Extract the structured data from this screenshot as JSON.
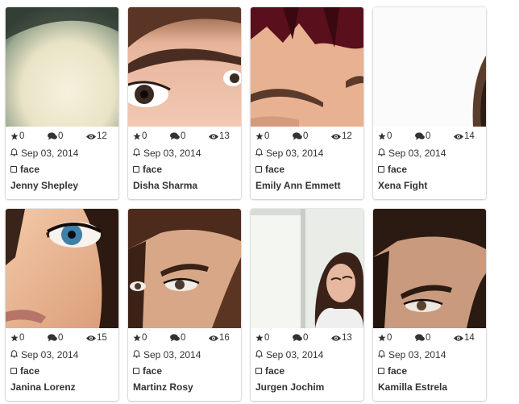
{
  "colors": {
    "text": "#333333",
    "card_bg": "#ffffff"
  },
  "cards": [
    {
      "name": "Jenny Shepley",
      "date": "Sep 03, 2014",
      "tag": "face",
      "stars": "0",
      "comments": "0",
      "views": "12",
      "photo": "face-photo"
    },
    {
      "name": "Disha Sharma",
      "date": "Sep 03, 2014",
      "tag": "face",
      "stars": "0",
      "comments": "0",
      "views": "13",
      "photo": "eye-closeup-photo"
    },
    {
      "name": "Emily Ann Emmett",
      "date": "Sep 03, 2014",
      "tag": "face",
      "stars": "0",
      "comments": "0",
      "views": "12",
      "photo": "eyebrow-closeup-photo"
    },
    {
      "name": "Xena Fight",
      "date": "Sep 03, 2014",
      "tag": "face",
      "stars": "0",
      "comments": "0",
      "views": "14",
      "photo": "face-photo"
    },
    {
      "name": "Janina Lorenz",
      "date": "Sep 03, 2014",
      "tag": "face",
      "stars": "0",
      "comments": "0",
      "views": "15",
      "photo": "blue-eye-closeup-photo"
    },
    {
      "name": "Martinz Rosy",
      "date": "Sep 03, 2014",
      "tag": "face",
      "stars": "0",
      "comments": "0",
      "views": "16",
      "photo": "face-portrait-photo"
    },
    {
      "name": "Jurgen Jochim",
      "date": "Sep 03, 2014",
      "tag": "face",
      "stars": "0",
      "comments": "0",
      "views": "13",
      "photo": "portrait-by-window-photo"
    },
    {
      "name": "Kamilla Estrela",
      "date": "Sep 03, 2014",
      "tag": "face",
      "stars": "0",
      "comments": "0",
      "views": "14",
      "photo": "face-portrait-photo"
    }
  ]
}
